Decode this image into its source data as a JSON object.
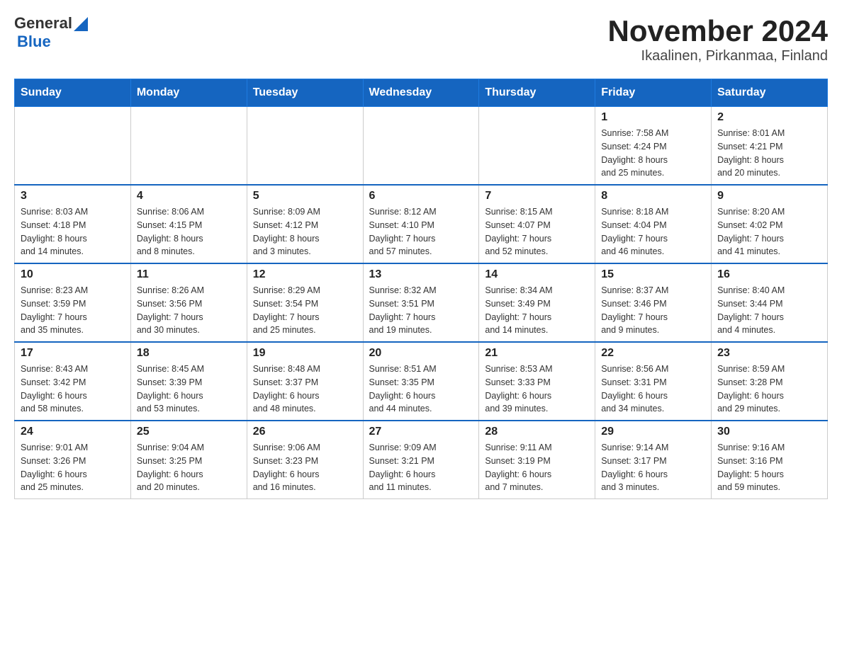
{
  "header": {
    "logo_general": "General",
    "logo_blue": "Blue",
    "title": "November 2024",
    "subtitle": "Ikaalinen, Pirkanmaa, Finland"
  },
  "days_of_week": [
    "Sunday",
    "Monday",
    "Tuesday",
    "Wednesday",
    "Thursday",
    "Friday",
    "Saturday"
  ],
  "weeks": [
    [
      {
        "day": "",
        "info": ""
      },
      {
        "day": "",
        "info": ""
      },
      {
        "day": "",
        "info": ""
      },
      {
        "day": "",
        "info": ""
      },
      {
        "day": "",
        "info": ""
      },
      {
        "day": "1",
        "info": "Sunrise: 7:58 AM\nSunset: 4:24 PM\nDaylight: 8 hours\nand 25 minutes."
      },
      {
        "day": "2",
        "info": "Sunrise: 8:01 AM\nSunset: 4:21 PM\nDaylight: 8 hours\nand 20 minutes."
      }
    ],
    [
      {
        "day": "3",
        "info": "Sunrise: 8:03 AM\nSunset: 4:18 PM\nDaylight: 8 hours\nand 14 minutes."
      },
      {
        "day": "4",
        "info": "Sunrise: 8:06 AM\nSunset: 4:15 PM\nDaylight: 8 hours\nand 8 minutes."
      },
      {
        "day": "5",
        "info": "Sunrise: 8:09 AM\nSunset: 4:12 PM\nDaylight: 8 hours\nand 3 minutes."
      },
      {
        "day": "6",
        "info": "Sunrise: 8:12 AM\nSunset: 4:10 PM\nDaylight: 7 hours\nand 57 minutes."
      },
      {
        "day": "7",
        "info": "Sunrise: 8:15 AM\nSunset: 4:07 PM\nDaylight: 7 hours\nand 52 minutes."
      },
      {
        "day": "8",
        "info": "Sunrise: 8:18 AM\nSunset: 4:04 PM\nDaylight: 7 hours\nand 46 minutes."
      },
      {
        "day": "9",
        "info": "Sunrise: 8:20 AM\nSunset: 4:02 PM\nDaylight: 7 hours\nand 41 minutes."
      }
    ],
    [
      {
        "day": "10",
        "info": "Sunrise: 8:23 AM\nSunset: 3:59 PM\nDaylight: 7 hours\nand 35 minutes."
      },
      {
        "day": "11",
        "info": "Sunrise: 8:26 AM\nSunset: 3:56 PM\nDaylight: 7 hours\nand 30 minutes."
      },
      {
        "day": "12",
        "info": "Sunrise: 8:29 AM\nSunset: 3:54 PM\nDaylight: 7 hours\nand 25 minutes."
      },
      {
        "day": "13",
        "info": "Sunrise: 8:32 AM\nSunset: 3:51 PM\nDaylight: 7 hours\nand 19 minutes."
      },
      {
        "day": "14",
        "info": "Sunrise: 8:34 AM\nSunset: 3:49 PM\nDaylight: 7 hours\nand 14 minutes."
      },
      {
        "day": "15",
        "info": "Sunrise: 8:37 AM\nSunset: 3:46 PM\nDaylight: 7 hours\nand 9 minutes."
      },
      {
        "day": "16",
        "info": "Sunrise: 8:40 AM\nSunset: 3:44 PM\nDaylight: 7 hours\nand 4 minutes."
      }
    ],
    [
      {
        "day": "17",
        "info": "Sunrise: 8:43 AM\nSunset: 3:42 PM\nDaylight: 6 hours\nand 58 minutes."
      },
      {
        "day": "18",
        "info": "Sunrise: 8:45 AM\nSunset: 3:39 PM\nDaylight: 6 hours\nand 53 minutes."
      },
      {
        "day": "19",
        "info": "Sunrise: 8:48 AM\nSunset: 3:37 PM\nDaylight: 6 hours\nand 48 minutes."
      },
      {
        "day": "20",
        "info": "Sunrise: 8:51 AM\nSunset: 3:35 PM\nDaylight: 6 hours\nand 44 minutes."
      },
      {
        "day": "21",
        "info": "Sunrise: 8:53 AM\nSunset: 3:33 PM\nDaylight: 6 hours\nand 39 minutes."
      },
      {
        "day": "22",
        "info": "Sunrise: 8:56 AM\nSunset: 3:31 PM\nDaylight: 6 hours\nand 34 minutes."
      },
      {
        "day": "23",
        "info": "Sunrise: 8:59 AM\nSunset: 3:28 PM\nDaylight: 6 hours\nand 29 minutes."
      }
    ],
    [
      {
        "day": "24",
        "info": "Sunrise: 9:01 AM\nSunset: 3:26 PM\nDaylight: 6 hours\nand 25 minutes."
      },
      {
        "day": "25",
        "info": "Sunrise: 9:04 AM\nSunset: 3:25 PM\nDaylight: 6 hours\nand 20 minutes."
      },
      {
        "day": "26",
        "info": "Sunrise: 9:06 AM\nSunset: 3:23 PM\nDaylight: 6 hours\nand 16 minutes."
      },
      {
        "day": "27",
        "info": "Sunrise: 9:09 AM\nSunset: 3:21 PM\nDaylight: 6 hours\nand 11 minutes."
      },
      {
        "day": "28",
        "info": "Sunrise: 9:11 AM\nSunset: 3:19 PM\nDaylight: 6 hours\nand 7 minutes."
      },
      {
        "day": "29",
        "info": "Sunrise: 9:14 AM\nSunset: 3:17 PM\nDaylight: 6 hours\nand 3 minutes."
      },
      {
        "day": "30",
        "info": "Sunrise: 9:16 AM\nSunset: 3:16 PM\nDaylight: 5 hours\nand 59 minutes."
      }
    ]
  ]
}
